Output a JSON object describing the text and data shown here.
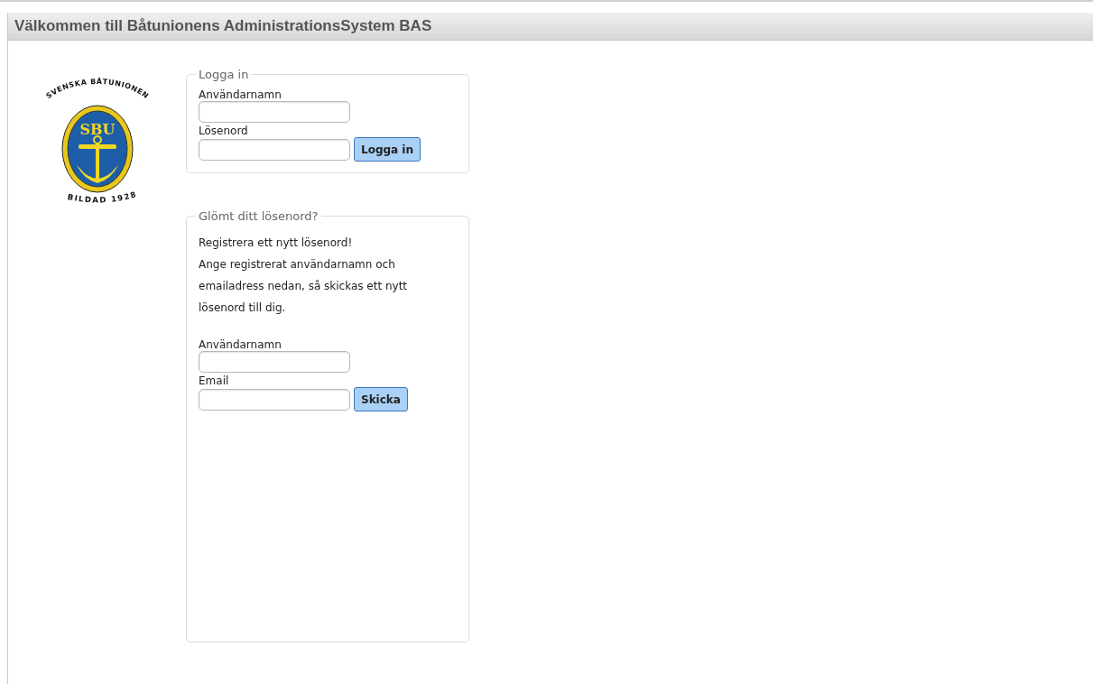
{
  "header": {
    "title": "Välkommen till Båtunionens AdministrationsSystem BAS"
  },
  "logo": {
    "ring_top": "SVENSKA BÅTUNIONEN",
    "ring_bottom": "BILDAD 1928",
    "initials": "SBU"
  },
  "login": {
    "legend": "Logga in",
    "fields": [
      {
        "label": "Användarnamn"
      },
      {
        "label": "Lösenord"
      }
    ],
    "button": "Logga in"
  },
  "forgot": {
    "legend": "Glömt ditt lösenord?",
    "heading": "Registrera ett nytt lösenord!",
    "text": "Ange registrerat användarnamn och emailadress nedan, så skickas ett nytt lösenord till dig.",
    "fields": [
      {
        "label": "Användarnamn"
      },
      {
        "label": "Email"
      }
    ],
    "button": "Skicka"
  }
}
